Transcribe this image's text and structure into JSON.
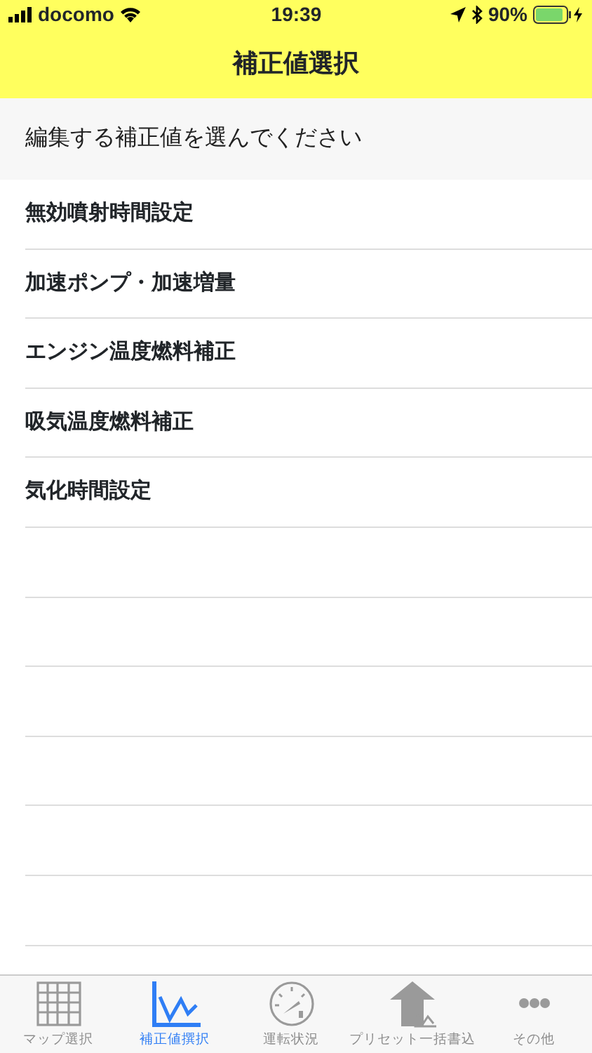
{
  "status_bar": {
    "carrier": "docomo",
    "time": "19:39",
    "battery": "90%"
  },
  "nav_bar": {
    "title": "補正値選択"
  },
  "section_header": "編集する補正値を選んでください",
  "items": [
    {
      "label": "無効噴射時間設定"
    },
    {
      "label": "加速ポンプ・加速増量"
    },
    {
      "label": "エンジン温度燃料補正"
    },
    {
      "label": "吸気温度燃料補正"
    },
    {
      "label": "気化時間設定"
    }
  ],
  "tab_bar": [
    {
      "kind": "grid",
      "label": "マップ選択",
      "selected": false
    },
    {
      "kind": "graph",
      "label": "補正値撰択",
      "selected": true
    },
    {
      "kind": "gauge",
      "label": "運転状況",
      "selected": false
    },
    {
      "kind": "upload",
      "label": "プリセット一括書込",
      "selected": false
    },
    {
      "kind": "more",
      "label": "その他",
      "selected": false
    }
  ]
}
